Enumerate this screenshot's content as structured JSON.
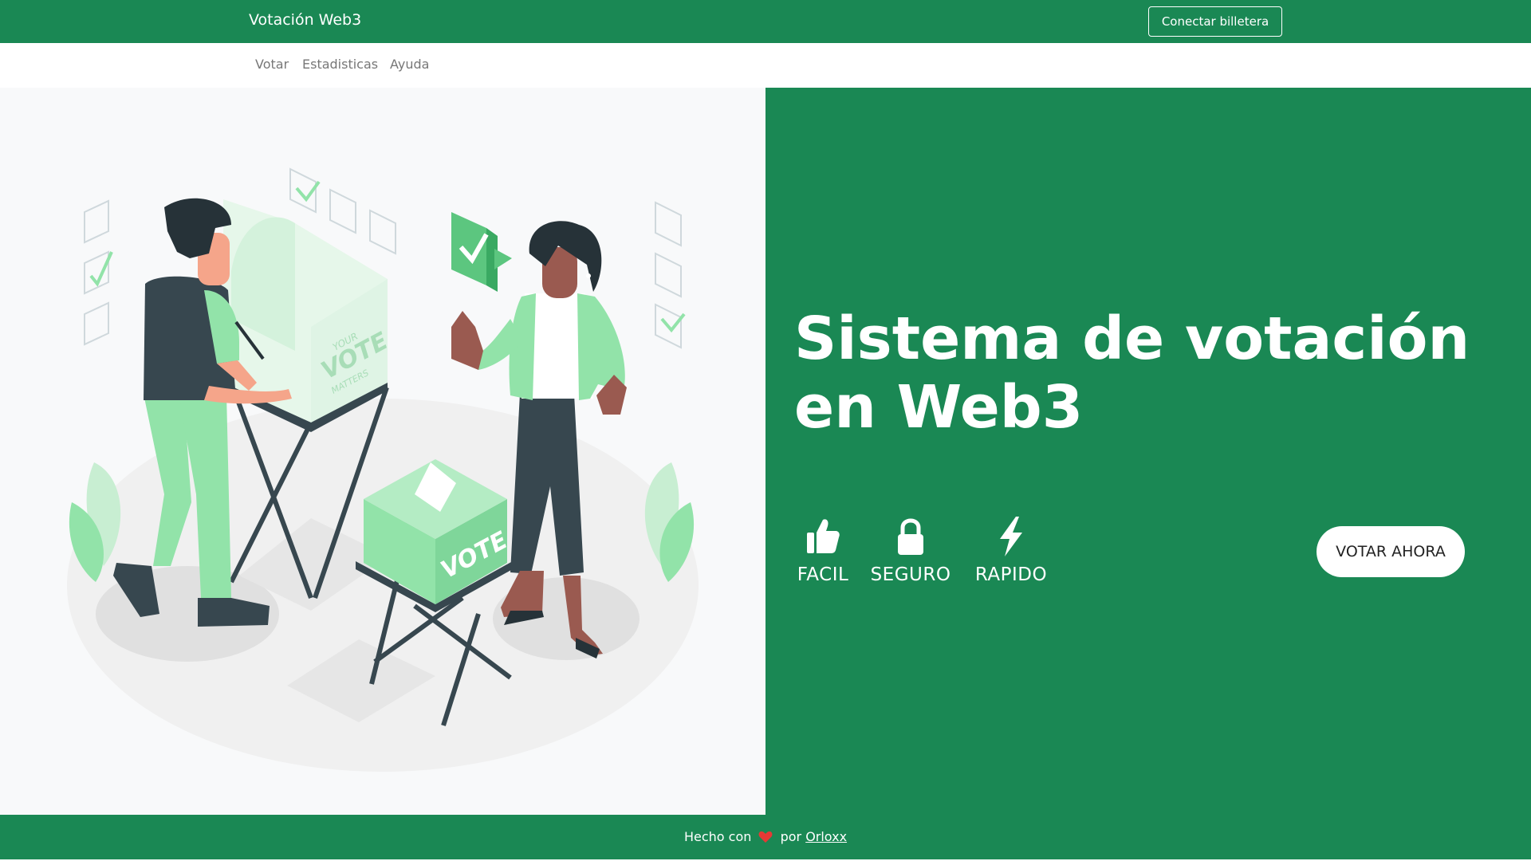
{
  "header": {
    "brand": "Votación Web3",
    "connect_label": "Conectar billetera"
  },
  "subnav": {
    "items": [
      "Votar",
      "Estadisticas",
      "Ayuda"
    ]
  },
  "hero": {
    "title": "Sistema de votación en Web3",
    "features": [
      {
        "label": "FACIL",
        "icon": "thumbs-up-icon"
      },
      {
        "label": "SEGURO",
        "icon": "lock-icon"
      },
      {
        "label": "RAPIDO",
        "icon": "lightning-icon"
      }
    ],
    "cta_label": "VOTAR AHORA"
  },
  "illustration": {
    "booth_text_1": "YOUR",
    "booth_text_2": "VOTE",
    "booth_text_3": "MATTERS",
    "box_text": "VOTE"
  },
  "footer": {
    "made_with": "Hecho con",
    "by": "por",
    "author": "Orloxx"
  },
  "colors": {
    "primary": "#1a8854",
    "accent_light": "#92e3a9",
    "dark": "#37474f",
    "heart": "#e53935"
  }
}
